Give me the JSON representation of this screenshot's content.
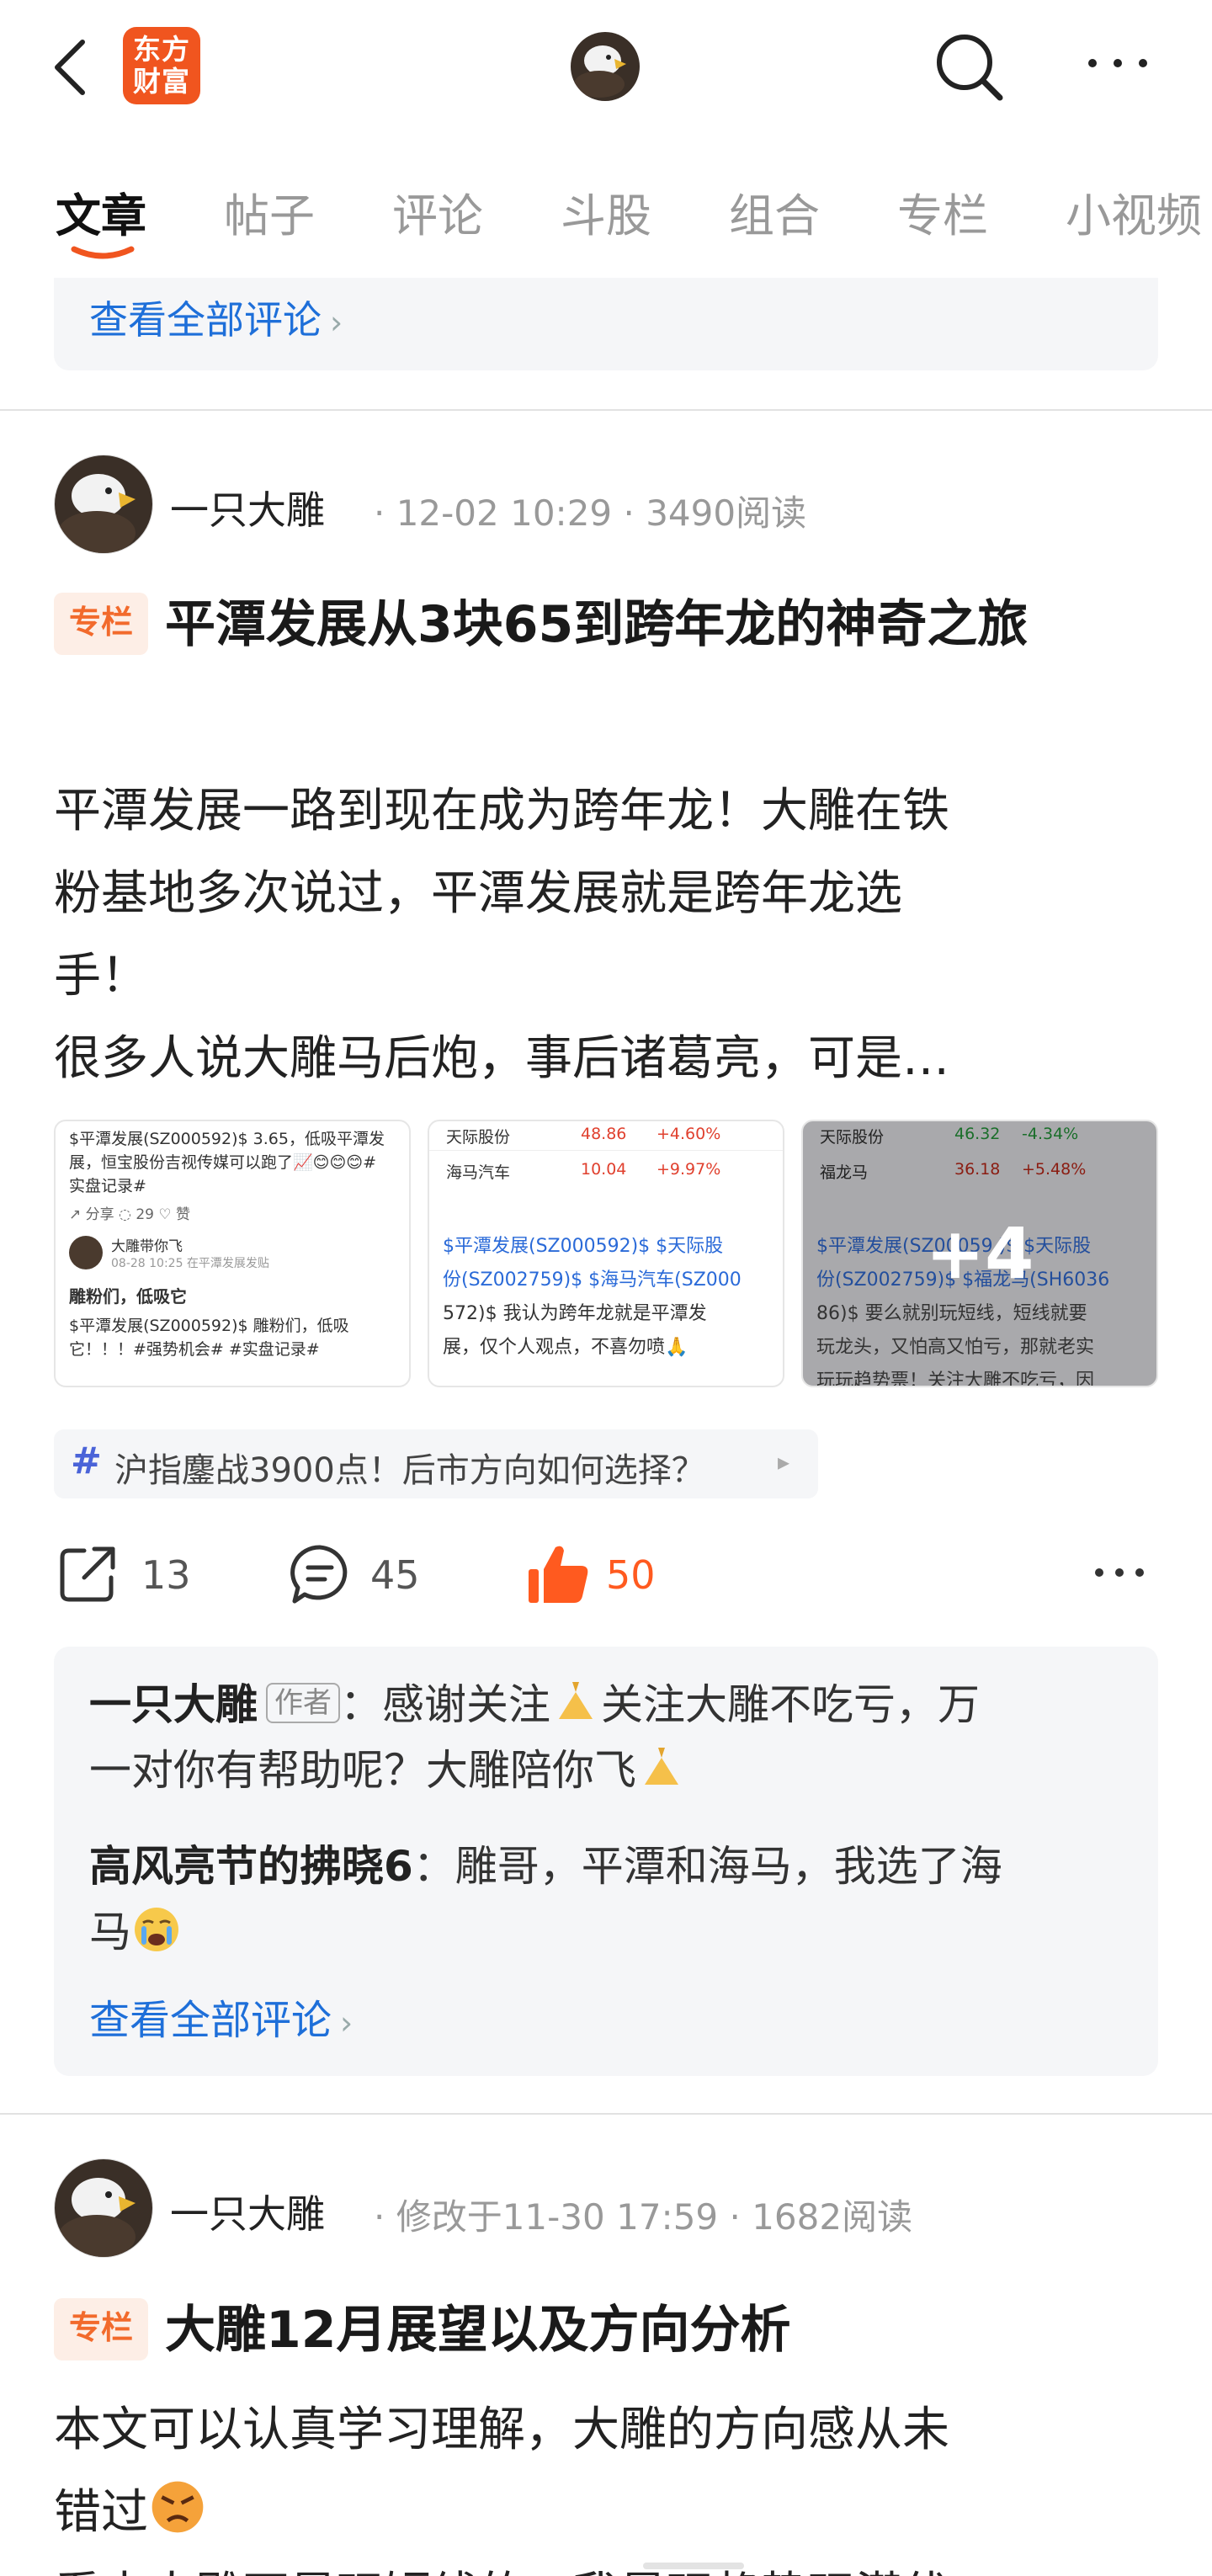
{
  "topbar": {
    "logo_line1": "东方",
    "logo_line2": "财富"
  },
  "tabs": [
    "文章",
    "帖子",
    "评论",
    "斗股",
    "组合",
    "专栏",
    "小视频"
  ],
  "prev_box": {
    "view_all": "查看全部评论"
  },
  "post1": {
    "author": "一只大雕",
    "date": "12-02 10:29",
    "reads": "3490阅读",
    "badge": "专栏",
    "title": "平潭发展从3块65到跨年龙的神奇之旅",
    "body_line1": "平潭发展一路到现在成为跨年龙！大雕在铁",
    "body_line2": "粉基地多次说过，平潭发展就是跨年龙选",
    "body_line3": "手！",
    "body_line4": "很多人说大雕马后炮，事后诸葛亮，可是…",
    "thumb1": {
      "line1": "$平潭发展(SZ000592)$ 3.65，低吸平潭发",
      "line2": "展，恒宝股份吉视传媒可以跑了📈😊😊😊#",
      "line3": "实盘记录#",
      "share": "分享",
      "comments": "29",
      "likes": "赞",
      "user": "大雕带你飞",
      "user_meta": "08-28 10:25  在平潭发展发贴",
      "headline": "雕粉们，低吸它",
      "line4": "$平潭发展(SZ000592)$ 雕粉们，低吸",
      "line5": "它！！！#强势机会# #实盘记录#"
    },
    "thumb2": {
      "r1_name": "天际股份",
      "r1_price": "48.86",
      "r1_pct": "+4.60%",
      "r2_name": "海马汽车",
      "r2_price": "10.04",
      "r2_pct": "+9.97%",
      "line1": "$平潭发展(SZ000592)$  $天际股",
      "line2": "份(SZ002759)$  $海马汽车(SZ000",
      "line3": "572)$  我认为跨年龙就是平潭发",
      "line4": "展，仅个人观点，不喜勿喷🙏"
    },
    "thumb3": {
      "r1_name": "天际股份",
      "r1_price": "46.32",
      "r1_pct": "-4.34%",
      "r2_name": "福龙马",
      "r2_price": "36.18",
      "r2_pct": "+5.48%",
      "line1": "$平潭发展(SZ00059 )$  $天际股",
      "line2": "份(SZ002759)$  $福龙马(SH6036",
      "line3": "86)$  要么就别玩短线，短线就要",
      "line4": "玩龙头，又怕高又怕亏，那就老实",
      "line5": "玩玩趋势票！关注大雕不吃亏，因",
      "more": "+4"
    },
    "topic": "沪指鏖战3900点！后市方向如何选择？",
    "shares": "13",
    "comments": "45",
    "likes": "50",
    "comment1_name": "一只大雕",
    "comment1_tag": "作者",
    "comment1_text_a": "：感谢关注",
    "comment1_text_b": "关注大雕不吃亏，万",
    "comment1_text_c": "一对你有帮助呢？大雕陪你飞",
    "comment2_name": "高风亮节的拂晓6",
    "comment2_text_a": "：雕哥，平潭和海马，我选了海",
    "comment2_text_b": "马",
    "view_all": "查看全部评论"
  },
  "post2": {
    "author": "一只大雕",
    "date": "修改于11-30 17:59",
    "reads": "1682阅读",
    "badge": "专栏",
    "title": "大雕12月展望以及方向分析",
    "body_line1": "本文可以认真学习理解，大雕的方向感从未",
    "body_line2": "错过",
    "body_line3": "看中大雕不是玩短线的，我是玩趋势玩潜伏"
  },
  "colors": {
    "accent": "#f26a2c",
    "link": "#1e6fd9",
    "like": "#ff5a1f"
  }
}
